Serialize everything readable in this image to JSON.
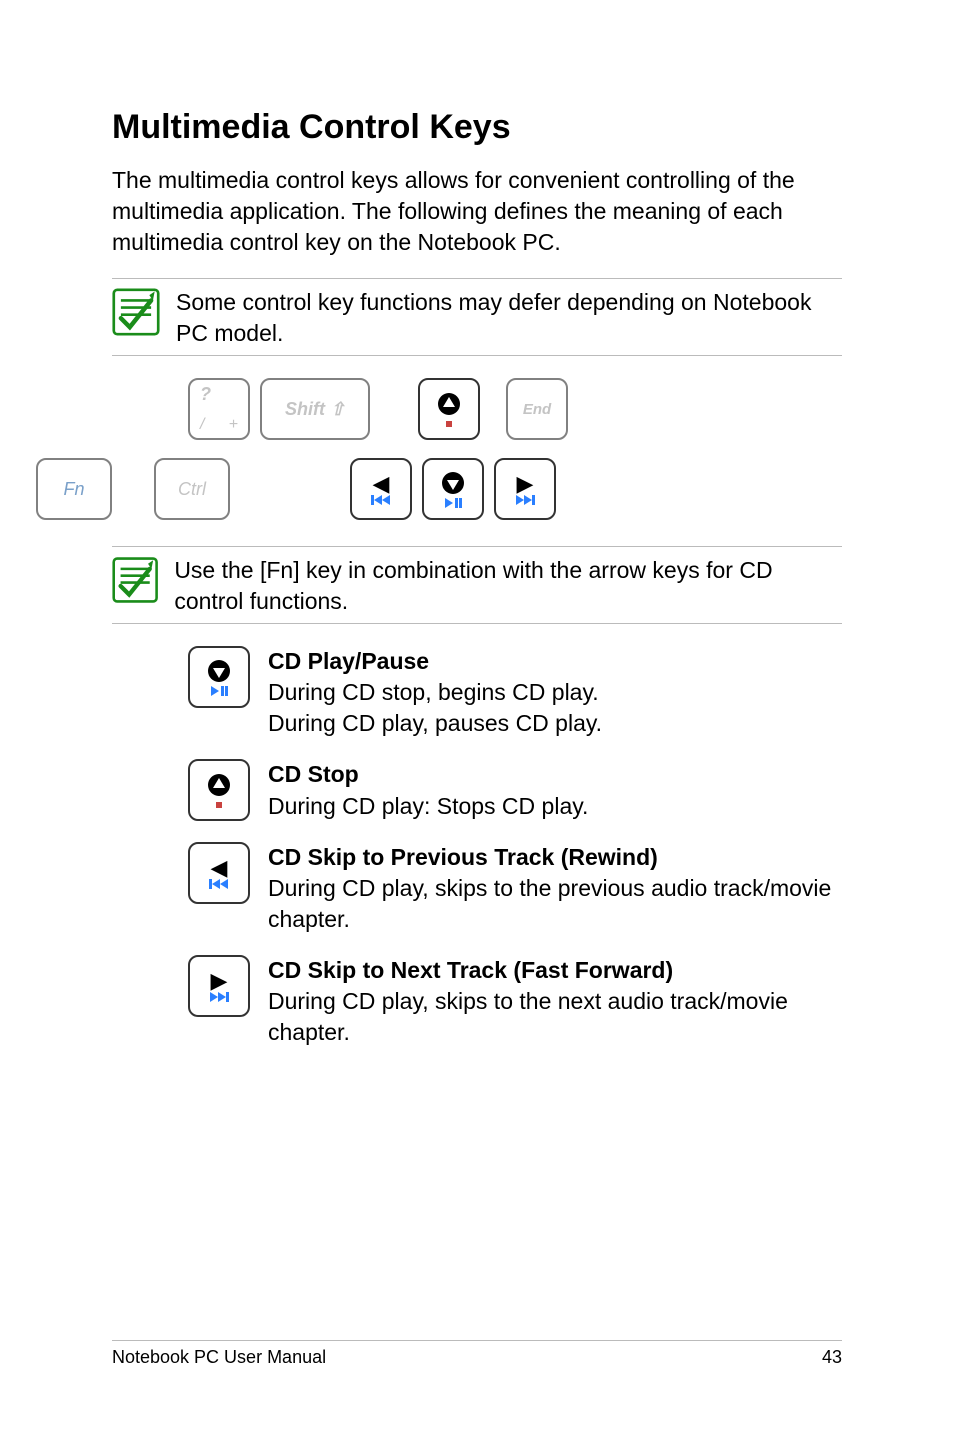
{
  "title": "Multimedia Control Keys",
  "intro": "The multimedia control keys allows for convenient controlling of the multimedia application. The following defines the meaning of each multimedia control key on the Notebook PC.",
  "note1": "Some control key functions may defer depending on Notebook PC model.",
  "note2": "Use the [Fn] key in combination with the arrow keys for CD control functions.",
  "keys": {
    "fn": "Fn",
    "ctrl": "Ctrl",
    "shift": "Shift ⇧",
    "end": "End",
    "question": "?",
    "slash": "/",
    "plus": "+"
  },
  "defs": {
    "playpause": {
      "title": "CD Play/Pause",
      "line1": "During CD stop, begins CD play.",
      "line2": "During CD play, pauses CD play."
    },
    "stop": {
      "title": "CD Stop",
      "line1": "During CD play: Stops CD play."
    },
    "prev": {
      "title": "CD Skip to Previous Track (Rewind)",
      "line1": "During CD play, skips to the previous audio track/movie chapter."
    },
    "next": {
      "title": "CD Skip to Next Track (Fast Forward)",
      "line1": "During CD play, skips to the next audio track/movie chapter."
    }
  },
  "footer": {
    "left": "Notebook PC User Manual",
    "right": "43"
  }
}
